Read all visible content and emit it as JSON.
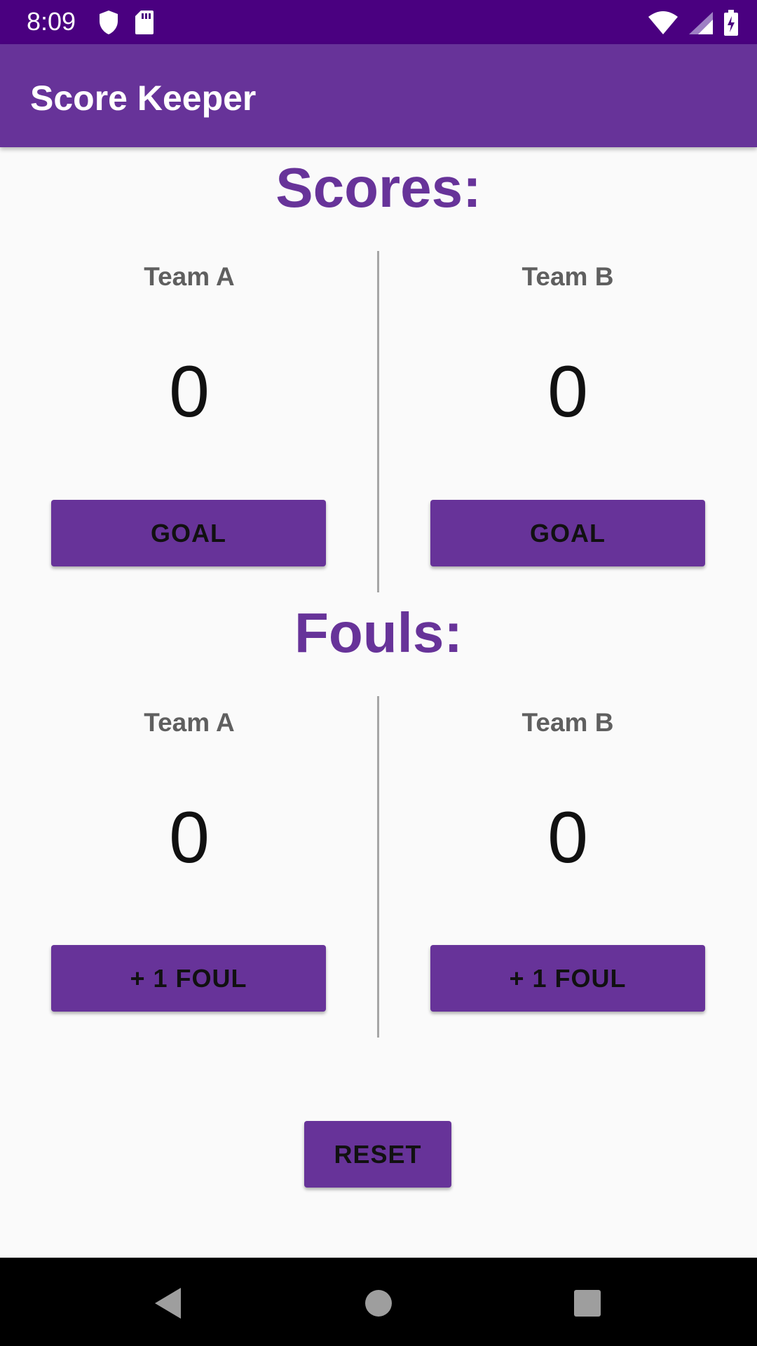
{
  "status_bar": {
    "time": "8:09",
    "left_icons": [
      "shield-icon",
      "sd-card-icon"
    ],
    "right_icons": [
      "wifi-icon",
      "signal-icon",
      "battery-charging-icon"
    ]
  },
  "app_bar": {
    "title": "Score Keeper",
    "color": "#673399"
  },
  "scores": {
    "heading": "Scores:",
    "team_a": {
      "label": "Team A",
      "value": "0",
      "button": "GOAL"
    },
    "team_b": {
      "label": "Team B",
      "value": "0",
      "button": "GOAL"
    }
  },
  "fouls": {
    "heading": "Fouls:",
    "team_a": {
      "label": "Team A",
      "value": "0",
      "button": "+ 1 FOUL"
    },
    "team_b": {
      "label": "Team B",
      "value": "0",
      "button": "+ 1 FOUL"
    }
  },
  "reset": {
    "label": "RESET"
  },
  "nav_bar": {
    "buttons": [
      "back-icon",
      "home-icon",
      "recents-icon"
    ]
  },
  "colors": {
    "status_bar": "#4a0080",
    "accent": "#673399",
    "background": "#fafafa"
  }
}
